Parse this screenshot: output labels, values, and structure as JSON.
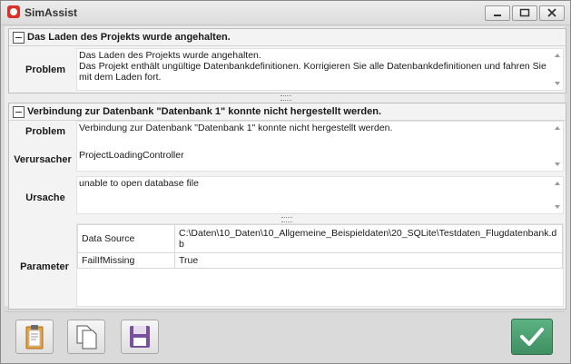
{
  "window": {
    "title": "SimAssist"
  },
  "group1": {
    "header": "Das Laden des Projekts wurde angehalten.",
    "problem_label": "Problem",
    "problem_text": "Das Laden des Projekts wurde angehalten.\nDas Projekt enthält ungültige Datenbankdefinitionen. Korrigieren Sie alle Datenbankdefinitionen und fahren Sie mit dem Laden fort."
  },
  "group2": {
    "header": "Verbindung zur Datenbank \"Datenbank 1\" konnte nicht hergestellt werden.",
    "problem_label": "Problem",
    "problem_text": "Verbindung zur Datenbank \"Datenbank 1\" konnte nicht hergestellt werden.",
    "verursacher_label": "Verursacher",
    "verursacher_text": "ProjectLoadingController",
    "ursache_label": "Ursache",
    "ursache_text": "unable to open database file",
    "parameter_label": "Parameter",
    "parameters": [
      {
        "name": "Data Source",
        "value": "C:\\Daten\\10_Daten\\10_Allgemeine_Beispieldaten\\20_SQLite\\Testdaten_Flugdatenbank.db"
      },
      {
        "name": "FailIfMissing",
        "value": "True"
      }
    ]
  },
  "toolbar": {
    "icons": [
      "clipboard-icon",
      "copy-icon",
      "save-icon",
      "checkmark-icon"
    ],
    "accent_color": "#4a9e6e"
  }
}
